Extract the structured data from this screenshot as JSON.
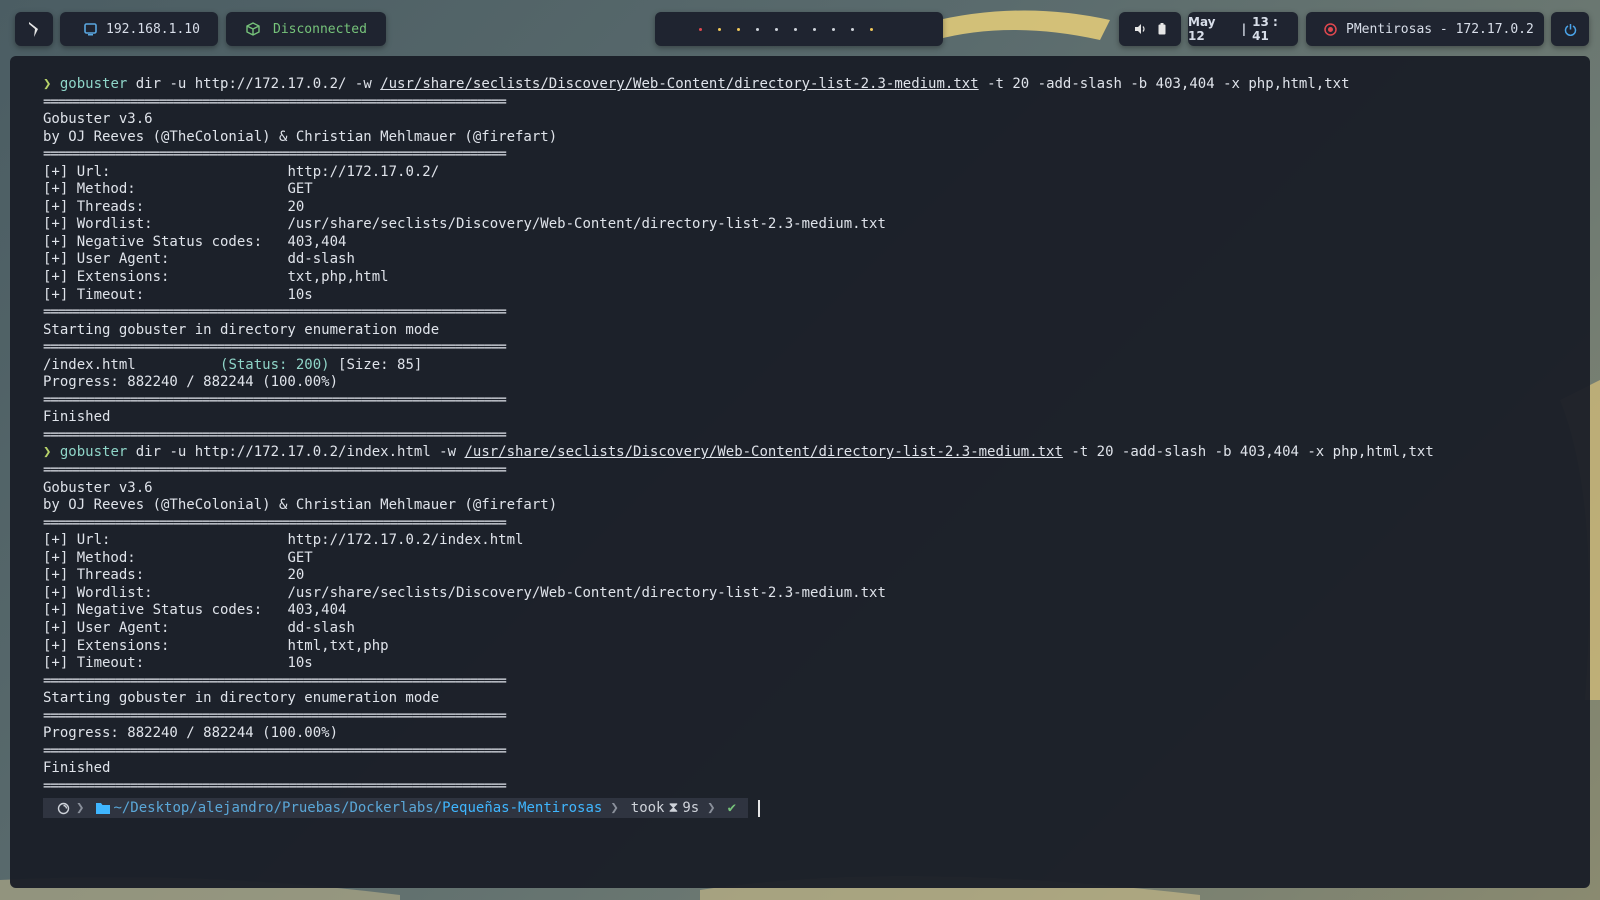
{
  "topbar": {
    "ip": "192.168.1.10",
    "vpn_status": "Disconnected",
    "workspace_dots": 10,
    "date": "May 12",
    "time_sep": "|",
    "time": "13 : 41",
    "target": "PMentirosas - 172.17.0.2",
    "colors": {
      "bar_bg": "#1f2430",
      "disconnected": "#76c37a",
      "target_icon": "#e0484f",
      "power": "#4aa3e8"
    }
  },
  "terminal": {
    "sep": "================================================================",
    "run1": {
      "prompt": "❯",
      "cmd": "gobuster",
      "args1": " dir -u http://172.17.0.2/ -w ",
      "wordlist": "/usr/share/seclists/Discovery/Web-Content/directory-list-2.3-medium.txt",
      "args2": " -t 20 -add-slash -b 403,404 -x php,html,txt",
      "version": "Gobuster v3.6",
      "authors": "by OJ Reeves (@TheColonial) & Christian Mehlmauer (@firefart)",
      "params": [
        {
          "k": "[+] Url:                     ",
          "v": "http://172.17.0.2/"
        },
        {
          "k": "[+] Method:                  ",
          "v": "GET"
        },
        {
          "k": "[+] Threads:                 ",
          "v": "20"
        },
        {
          "k": "[+] Wordlist:                ",
          "v": "/usr/share/seclists/Discovery/Web-Content/directory-list-2.3-medium.txt"
        },
        {
          "k": "[+] Negative Status codes:   ",
          "v": "403,404"
        },
        {
          "k": "[+] User Agent:              ",
          "v": "dd-slash"
        },
        {
          "k": "[+] Extensions:              ",
          "v": "txt,php,html"
        },
        {
          "k": "[+] Timeout:                 ",
          "v": "10s"
        }
      ],
      "starting": "Starting gobuster in directory enumeration mode",
      "result_path": "/index.html          ",
      "result_status": "(Status: 200)",
      "result_size": " [Size: 85]",
      "progress": "Progress: 882240 / 882244 (100.00%)",
      "finished": "Finished"
    },
    "run2": {
      "prompt": "❯",
      "cmd": "gobuster",
      "args1": " dir -u http://172.17.0.2/index.html -w ",
      "wordlist": "/usr/share/seclists/Discovery/Web-Content/directory-list-2.3-medium.txt",
      "args2": " -t 20 -add-slash -b 403,404 -x php,html,txt",
      "version": "Gobuster v3.6",
      "authors": "by OJ Reeves (@TheColonial) & Christian Mehlmauer (@firefart)",
      "params": [
        {
          "k": "[+] Url:                     ",
          "v": "http://172.17.0.2/index.html"
        },
        {
          "k": "[+] Method:                  ",
          "v": "GET"
        },
        {
          "k": "[+] Threads:                 ",
          "v": "20"
        },
        {
          "k": "[+] Wordlist:                ",
          "v": "/usr/share/seclists/Discovery/Web-Content/directory-list-2.3-medium.txt"
        },
        {
          "k": "[+] Negative Status codes:   ",
          "v": "403,404"
        },
        {
          "k": "[+] User Agent:              ",
          "v": "dd-slash"
        },
        {
          "k": "[+] Extensions:              ",
          "v": "html,txt,php"
        },
        {
          "k": "[+] Timeout:                 ",
          "v": "10s"
        }
      ],
      "starting": "Starting gobuster in directory enumeration mode",
      "progress": "Progress: 882240 / 882244 (100.00%)",
      "finished": "Finished"
    },
    "prompt": {
      "path": "~/Desktop/alejandro/Pruebas/Dockerlabs/",
      "dir": "Pequeñas-Mentirosas",
      "took": "took",
      "duration": "9s",
      "check": "✔"
    }
  }
}
